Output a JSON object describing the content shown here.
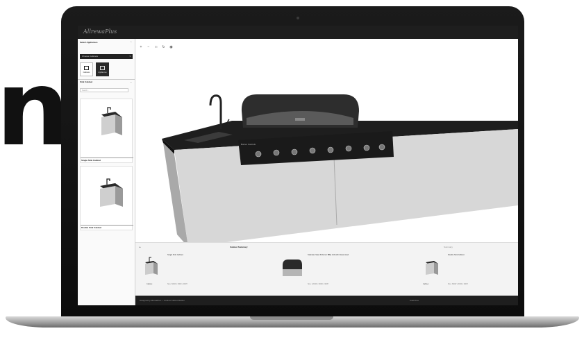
{
  "hero_letter": "n",
  "app": {
    "logo": "AllrewaPlus"
  },
  "sidebar": {
    "select_heading": "Select Appliances",
    "dropdown_value": "Choose Cabinets",
    "tabs": [
      {
        "label": "Cabinets",
        "icon": "cabinet-icon",
        "active": false
      },
      {
        "label": "Appliances",
        "icon": "appliance-icon",
        "active": true
      }
    ],
    "section_heading": "Sink Cabinet",
    "search_placeholder": "Search...",
    "cards": [
      {
        "label": "Single Sink Cabinet"
      },
      {
        "label": "Double Sink Cabinet"
      }
    ]
  },
  "toolbar": {
    "tools": [
      "zoom-in-icon",
      "zoom-out-icon",
      "fit-icon",
      "rotate-icon",
      "camera-icon"
    ]
  },
  "scene": {
    "control_panel_label": "Burner Controls"
  },
  "bottom_panel": {
    "tab_active": "Cabinet Summary",
    "tab_right": "Summary",
    "products": [
      {
        "name": "Single Sink Cabinet",
        "tag": "Cabinet",
        "meta": "Size: 600W x 600D x 900H"
      },
      {
        "name": "Stainless Steel 6-Burner BBQ Grill with Glass Hood",
        "tag": "",
        "meta": "Size: 1200W x 600D x 900H"
      },
      {
        "name": "Double Sink Cabinet",
        "tag": "Cabinet",
        "meta": "Size: 600W x 600D x 900H"
      }
    ]
  },
  "status_bar": {
    "left": "Designed by AllrewaPlus — Outdoor Kitchen Builder",
    "right": "Total Price"
  }
}
